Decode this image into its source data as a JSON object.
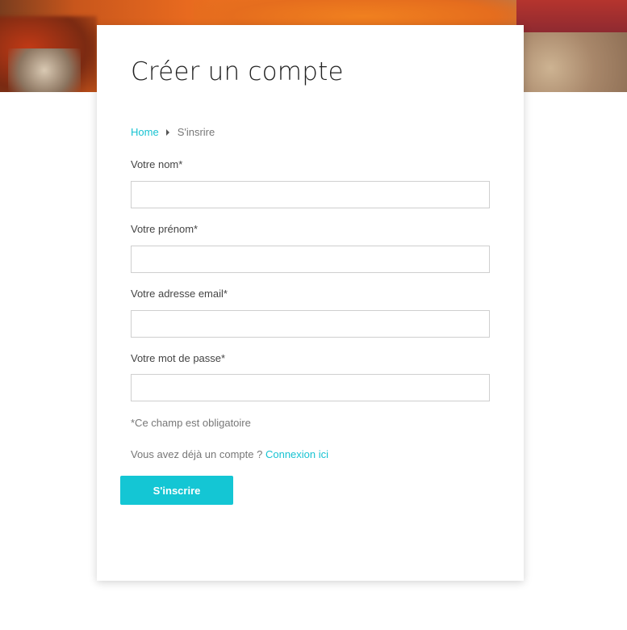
{
  "page": {
    "title": "Créer un compte"
  },
  "breadcrumb": {
    "home": "Home",
    "current": "S'insrire"
  },
  "form": {
    "fields": [
      {
        "label": "Votre nom*",
        "value": "",
        "placeholder": ""
      },
      {
        "label": "Votre prénom*",
        "value": "",
        "placeholder": ""
      },
      {
        "label": "Votre adresse email*",
        "value": "",
        "placeholder": ""
      },
      {
        "label": "Votre mot de passe*",
        "value": "",
        "placeholder": ""
      }
    ],
    "required_note": "*Ce champ est obligatoire",
    "login_prompt": "Vous avez déjà un compte ?",
    "login_link": "Connexion ici",
    "submit_label": "S'inscrire"
  },
  "colors": {
    "accent": "#14c6d4",
    "link": "#17c3d2",
    "text": "#444444",
    "muted": "#777777"
  }
}
